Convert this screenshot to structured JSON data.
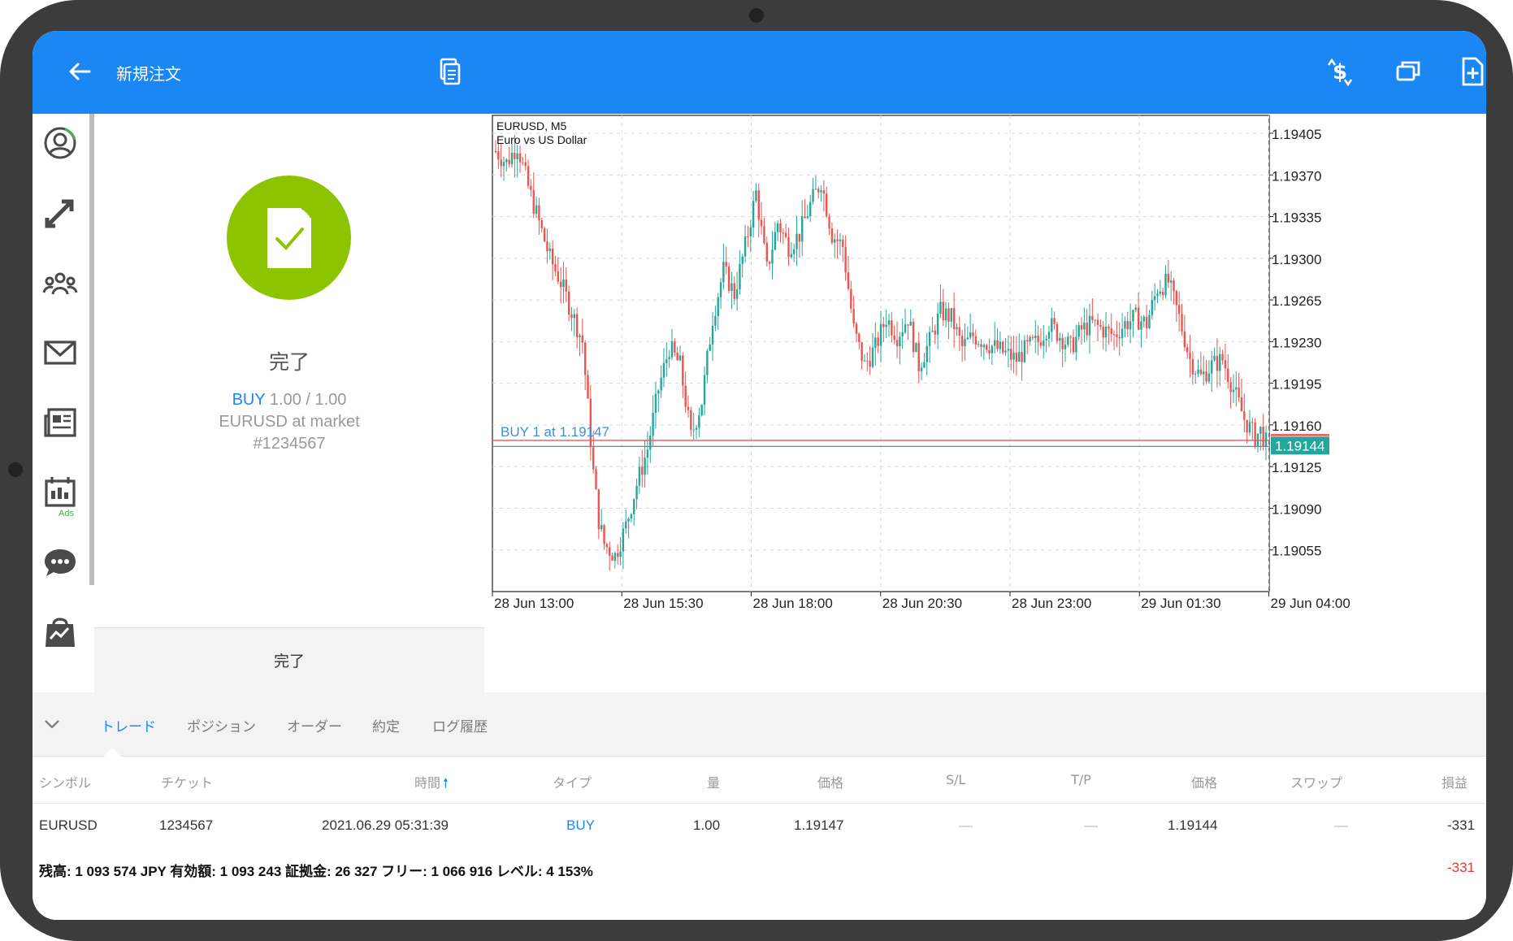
{
  "header": {
    "title": "新規注文"
  },
  "order_result": {
    "status": "完了",
    "side": "BUY",
    "volume": "1.00 / 1.00",
    "instrument": "EURUSD at market",
    "ticket": "#1234567",
    "done_button": "完了"
  },
  "sidebar": {
    "ads_badge": "Ads"
  },
  "chart": {
    "symbol_line": "EURUSD, M5",
    "description": "Euro vs US Dollar",
    "price_labels": [
      "1.19405",
      "1.19370",
      "1.19335",
      "1.19300",
      "1.19265",
      "1.19230",
      "1.19195",
      "1.19160",
      "1.19125",
      "1.19090",
      "1.19055"
    ],
    "time_labels": [
      "28 Jun 13:00",
      "28 Jun 15:30",
      "28 Jun 18:00",
      "28 Jun 20:30",
      "28 Jun 23:00",
      "29 Jun 01:30",
      "29 Jun 04:00"
    ],
    "buy_line_label": "BUY 1 at 1.19147",
    "current_price": "1.19144",
    "colors": {
      "bull": "#26a69a",
      "bear": "#ef5350",
      "buy_line": "#3d8fd6"
    }
  },
  "chart_data": {
    "type": "candlestick",
    "symbol": "EURUSD",
    "timeframe": "M5",
    "ylim": [
      1.1902,
      1.1942
    ],
    "x_ticks": [
      "28 Jun 13:00",
      "28 Jun 15:30",
      "28 Jun 18:00",
      "28 Jun 20:30",
      "28 Jun 23:00",
      "29 Jun 01:30",
      "29 Jun 04:00"
    ],
    "y_ticks": [
      1.19405,
      1.1937,
      1.19335,
      1.193,
      1.19265,
      1.1923,
      1.19195,
      1.1916,
      1.19125,
      1.1909,
      1.19055
    ],
    "close_path": [
      [
        0,
        1.1939
      ],
      [
        4,
        1.1938
      ],
      [
        8,
        1.19395
      ],
      [
        12,
        1.1936
      ],
      [
        16,
        1.1933
      ],
      [
        20,
        1.193
      ],
      [
        24,
        1.1928
      ],
      [
        28,
        1.19255
      ],
      [
        32,
        1.1923
      ],
      [
        36,
        1.1912
      ],
      [
        38,
        1.1908
      ],
      [
        40,
        1.1906
      ],
      [
        44,
        1.1905
      ],
      [
        48,
        1.19075
      ],
      [
        52,
        1.1911
      ],
      [
        56,
        1.1914
      ],
      [
        60,
        1.1919
      ],
      [
        64,
        1.19225
      ],
      [
        68,
        1.1921
      ],
      [
        72,
        1.1915
      ],
      [
        76,
        1.1918
      ],
      [
        80,
        1.1925
      ],
      [
        84,
        1.1929
      ],
      [
        88,
        1.1927
      ],
      [
        92,
        1.1931
      ],
      [
        96,
        1.19355
      ],
      [
        100,
        1.1929
      ],
      [
        104,
        1.1933
      ],
      [
        108,
        1.1931
      ],
      [
        112,
        1.1932
      ],
      [
        116,
        1.19345
      ],
      [
        120,
        1.19365
      ],
      [
        124,
        1.1932
      ],
      [
        128,
        1.1931
      ],
      [
        132,
        1.1924
      ],
      [
        136,
        1.1921
      ],
      [
        140,
        1.19225
      ],
      [
        144,
        1.1925
      ],
      [
        148,
        1.19235
      ],
      [
        152,
        1.1925
      ],
      [
        156,
        1.1921
      ],
      [
        160,
        1.1923
      ],
      [
        164,
        1.19255
      ],
      [
        168,
        1.1925
      ],
      [
        172,
        1.19225
      ],
      [
        176,
        1.19235
      ],
      [
        180,
        1.1923
      ],
      [
        184,
        1.19225
      ],
      [
        188,
        1.1922
      ],
      [
        192,
        1.19215
      ],
      [
        196,
        1.19225
      ],
      [
        200,
        1.1923
      ],
      [
        204,
        1.19245
      ],
      [
        208,
        1.19235
      ],
      [
        212,
        1.19225
      ],
      [
        216,
        1.1924
      ],
      [
        220,
        1.19245
      ],
      [
        224,
        1.1924
      ],
      [
        228,
        1.19235
      ],
      [
        232,
        1.19245
      ],
      [
        236,
        1.1925
      ],
      [
        240,
        1.19245
      ],
      [
        244,
        1.19275
      ],
      [
        248,
        1.1928
      ],
      [
        252,
        1.1925
      ],
      [
        256,
        1.19215
      ],
      [
        260,
        1.192
      ],
      [
        264,
        1.1921
      ],
      [
        268,
        1.19215
      ],
      [
        272,
        1.1919
      ],
      [
        276,
        1.19165
      ],
      [
        280,
        1.1915
      ],
      [
        282,
        1.19155
      ],
      [
        284,
        1.19145
      ]
    ],
    "current_price": 1.19144,
    "order_line": 1.19147
  },
  "tabs": [
    "トレード",
    "ポジション",
    "オーダー",
    "約定",
    "ログ履歴"
  ],
  "table": {
    "headers": [
      "シンボル",
      "チケット",
      "時間",
      "タイプ",
      "量",
      "価格",
      "S/L",
      "T/P",
      "価格",
      "スワップ",
      "損益"
    ],
    "row": [
      "EURUSD",
      "1234567",
      "2021.06.29 05:31:39",
      "BUY",
      "1.00",
      "1.19147",
      "—",
      "—",
      "1.19144",
      "—",
      "-331"
    ]
  },
  "summary": {
    "text": "残高:  1 093 574 JPY   有効額:  1 093 243   証拠金:  26 327   フリー:  1 066 916   レベル:  4 153%",
    "profit": "-331"
  }
}
